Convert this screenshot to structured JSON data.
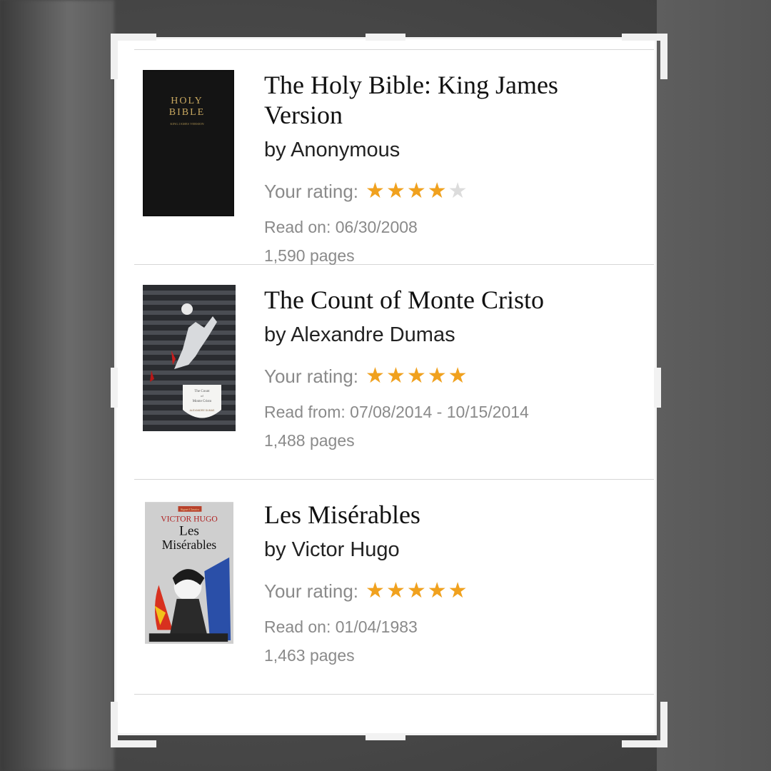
{
  "colors": {
    "star_filled": "#f0a11e",
    "star_empty": "#dcdcdc",
    "muted_text": "#8a8a8a"
  },
  "books": [
    {
      "title": "The Holy Bible: King James Version",
      "author": "by Anonymous",
      "rating_label": "Your rating:",
      "rating": 4,
      "rating_max": 5,
      "date": "Read on: 06/30/2008",
      "pages": "1,590 pages",
      "cover": {
        "line1": "HOLY",
        "line2": "BIBLE",
        "line3": "KING JAMES VERSION"
      }
    },
    {
      "title": "The Count of Monte Cristo",
      "author": "by Alexandre Dumas",
      "rating_label": "Your rating:",
      "rating": 5,
      "rating_max": 5,
      "date": "Read from: 07/08/2014 - 10/15/2014",
      "pages": "1,488 pages",
      "cover": {
        "line1": "The Count",
        "line2": "of",
        "line3": "Monte Cristo",
        "author": "ALEXANDRE DUMAS"
      }
    },
    {
      "title": "Les Misérables",
      "author": "by Victor Hugo",
      "rating_label": "Your rating:",
      "rating": 5,
      "rating_max": 5,
      "date": "Read on: 01/04/1983",
      "pages": "1,463 pages",
      "cover": {
        "badge": "Signet Classics",
        "author": "VICTOR HUGO",
        "line1": "Les",
        "line2": "Misérables"
      }
    }
  ]
}
